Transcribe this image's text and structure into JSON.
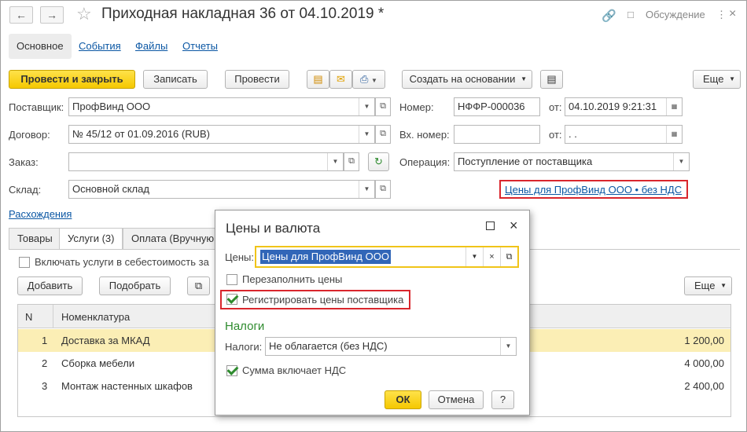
{
  "window": {
    "title": "Приходная накладная 36 от 04.10.2019 *",
    "discuss_label": "Обсуждение"
  },
  "top_tabs": [
    "Основное",
    "События",
    "Файлы",
    "Отчеты"
  ],
  "toolbar": {
    "post_close": "Провести и закрыть",
    "save": "Записать",
    "post": "Провести",
    "create_based": "Создать на основании",
    "more": "Еще"
  },
  "form": {
    "supplier_label": "Поставщик:",
    "supplier_value": "ПрофВинд ООО",
    "contract_label": "Договор:",
    "contract_value": "№ 45/12 от 01.09.2016 (RUB)",
    "order_label": "Заказ:",
    "order_value": "",
    "warehouse_label": "Склад:",
    "warehouse_value": "Основной склад",
    "number_label": "Номер:",
    "number_value": "НФФР-000036",
    "from_label": "от:",
    "date_value": "04.10.2019  9:21:31",
    "in_number_label": "Вх. номер:",
    "in_number_value": "",
    "from2_label": "от:",
    "in_date_value": " .  .",
    "operation_label": "Операция:",
    "operation_value": "Поступление от поставщика",
    "prices_link": "Цены для ПрофВинд ООО • без НДС",
    "discrepancies_link": "Расхождения"
  },
  "goods_tabs": [
    "Товары",
    "Услуги (3)",
    "Оплата (Вручную"
  ],
  "services": {
    "include_cost_label": "Включать услуги в себестоимость за",
    "add": "Добавить",
    "pick": "Подобрать",
    "more": "Еще",
    "columns": {
      "n": "N",
      "item": "Номенклатура"
    },
    "rows": [
      {
        "n": "1",
        "item": "Доставка за МКАД",
        "sum": "1 200,00"
      },
      {
        "n": "2",
        "item": "Сборка мебели",
        "sum": "4 000,00"
      },
      {
        "n": "3",
        "item": "Монтаж настенных шкафов",
        "sum": "2 400,00"
      }
    ]
  },
  "dialog": {
    "title": "Цены и валюта",
    "prices_label": "Цены:",
    "prices_value": "Цены для ПрофВинд ООО",
    "refill_label": "Перезаполнить цены",
    "register_label": "Регистрировать цены поставщика",
    "taxes_header": "Налоги",
    "taxes_label": "Налоги:",
    "taxes_value": "Не облагается (без НДС)",
    "sum_incl_label": "Сумма включает НДС",
    "ok": "ОК",
    "cancel": "Отмена",
    "help": "?"
  }
}
